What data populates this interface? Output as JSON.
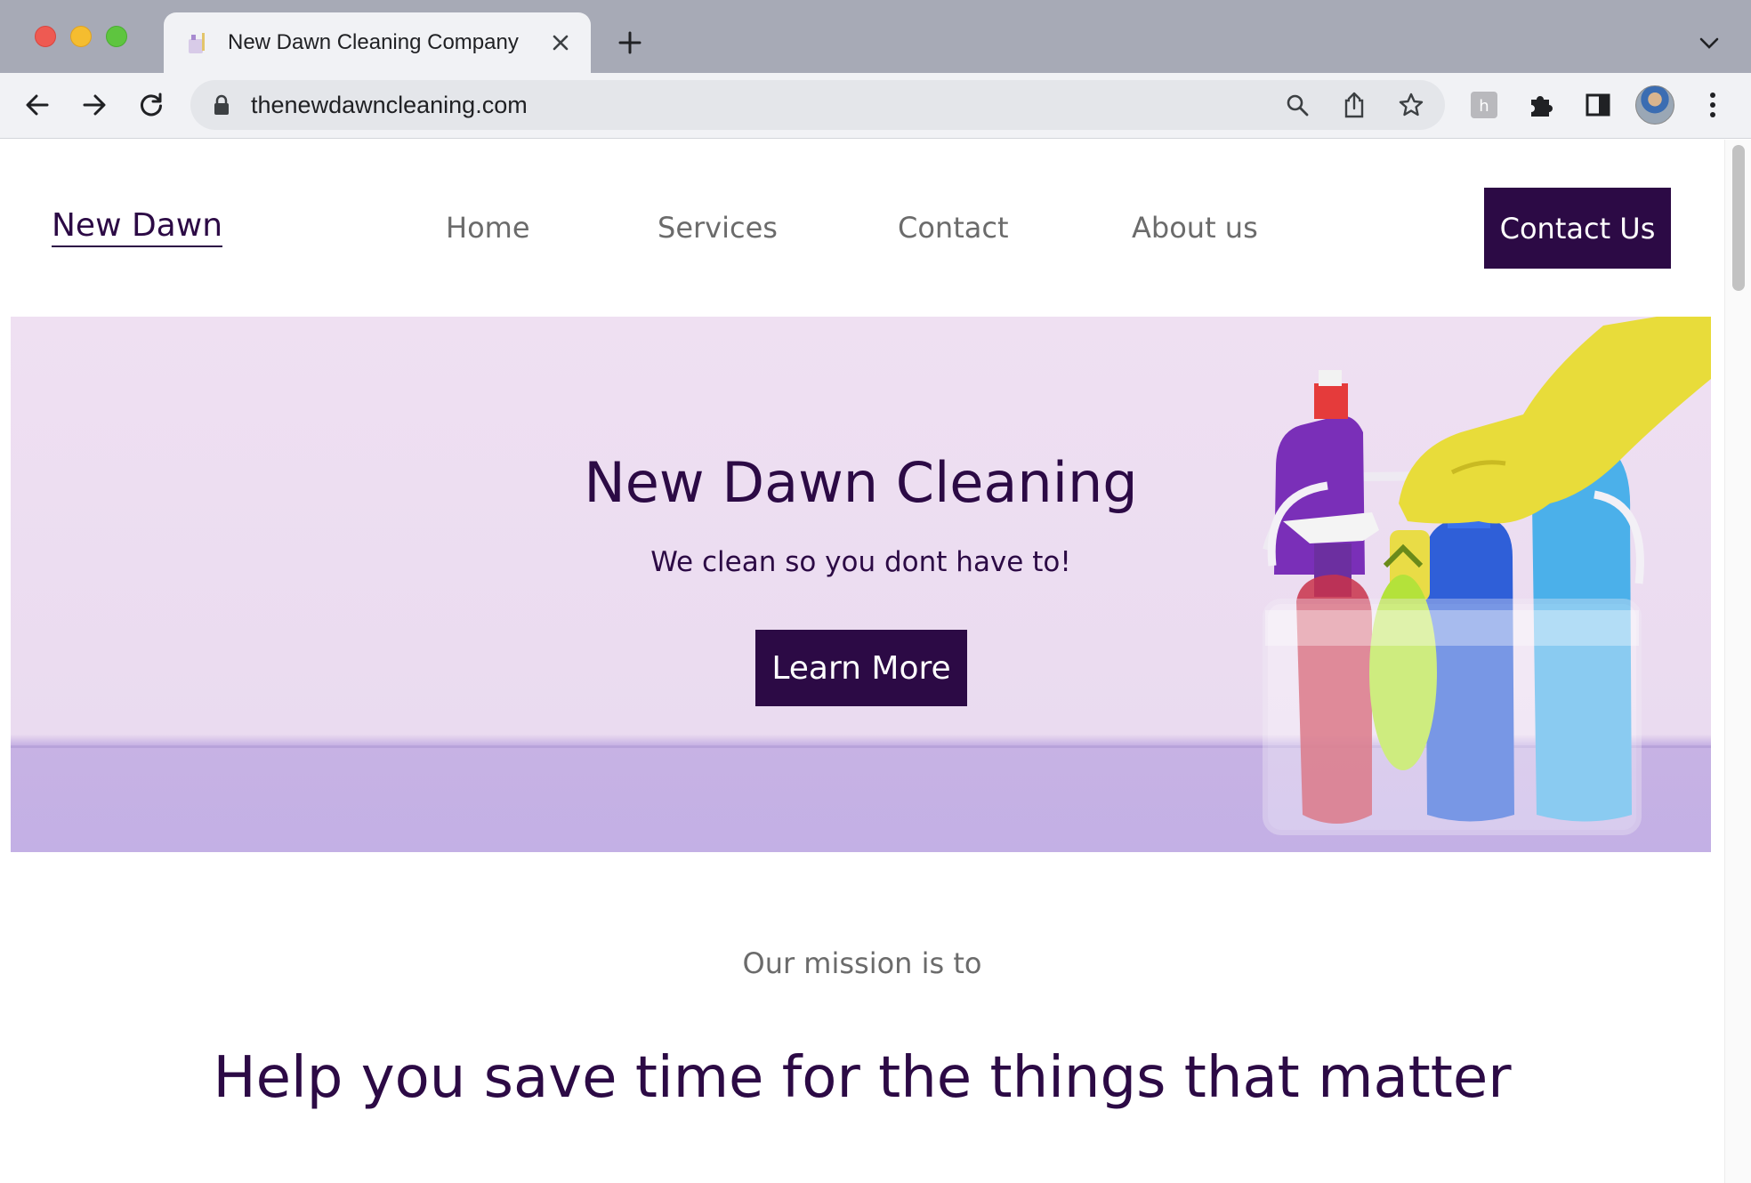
{
  "browser": {
    "tab_title": "New Dawn Cleaning Company",
    "url": "thenewdawncleaning.com",
    "icons": [
      "back-icon",
      "forward-icon",
      "reload-icon",
      "lock-icon",
      "search-icon",
      "share-icon",
      "star-icon",
      "extension-h-icon",
      "puzzle-icon",
      "sidepanel-icon",
      "kebab-menu-icon"
    ]
  },
  "site": {
    "logo": "New Dawn",
    "nav": [
      "Home",
      "Services",
      "Contact",
      "About us"
    ],
    "cta": "Contact Us",
    "hero": {
      "title": "New Dawn Cleaning",
      "subtitle": "We clean so you dont have to!",
      "button": "Learn More"
    },
    "mission": {
      "kicker": "Our mission is to",
      "title": "Help you save time for the things that matter"
    }
  },
  "colors": {
    "brand": "#2c0a45",
    "nav_text": "#6b6b6b",
    "hero_bg": "#eadbf0"
  }
}
